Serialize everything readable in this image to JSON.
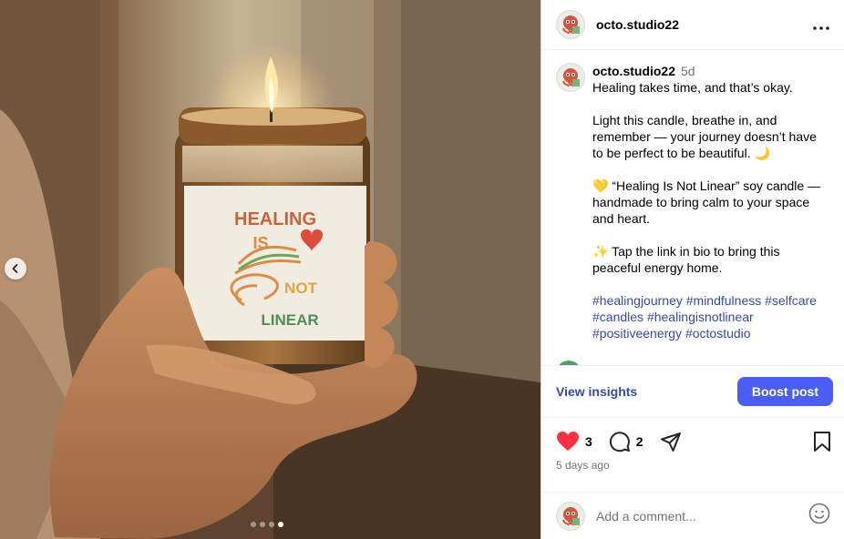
{
  "post": {
    "username": "octo.studio22",
    "time_ago": "5d",
    "date": "5 days ago",
    "likes": "3",
    "comments": "2",
    "caption": {
      "line1": "Healing takes time, and that’s okay.",
      "para2": "Light this candle, breathe in, and remember — your journey doesn’t have to be perfect to be beautiful. 🌙",
      "para3": "💛 “Healing Is Not Linear” soy candle — handmade to bring calm to your space and heart.",
      "para4": "✨ Tap the link in bio to bring this peaceful energy home.",
      "hashtags": [
        "#healingjourney",
        "#mindfulness",
        "#selfcare",
        "#candles",
        "#healingisnotlinear",
        "#positiveenergy",
        "#octostudio"
      ]
    }
  },
  "image": {
    "label_text": [
      "HEALING",
      "IS",
      "NOT",
      "LINEAR"
    ],
    "carousel_count": 4,
    "carousel_active": 4
  },
  "actions": {
    "view_insights": "View insights",
    "boost_post": "Boost post"
  },
  "comment": {
    "placeholder": "Add a comment..."
  },
  "icons": [
    "chevron-left-icon",
    "more-icon",
    "heart-icon",
    "comment-icon",
    "share-icon",
    "bookmark-icon",
    "emoji-icon"
  ],
  "colors": {
    "accent": "#4a5ef5",
    "link": "#3949ab",
    "like": "#ff3040"
  }
}
